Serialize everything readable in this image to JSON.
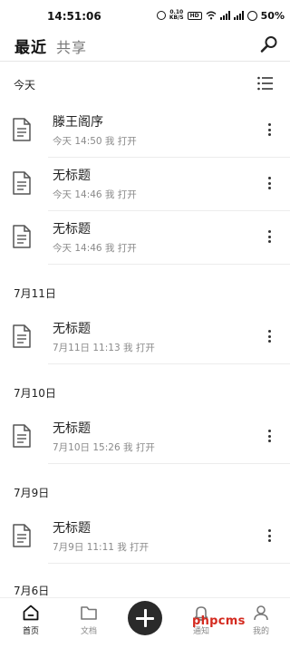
{
  "status_bar": {
    "time": "14:51:06",
    "net_speed_value": "0.10",
    "net_speed_unit": "KB/S",
    "hd_badge": "HD",
    "battery_percent": "50%"
  },
  "header": {
    "tab_recent": "最近",
    "tab_shared": "共享"
  },
  "sections": [
    {
      "title": "今天",
      "items": [
        {
          "title": "滕王阁序",
          "subtitle": "今天 14:50 我 打开"
        },
        {
          "title": "无标题",
          "subtitle": "今天 14:46 我 打开"
        },
        {
          "title": "无标题",
          "subtitle": "今天 14:46 我 打开"
        }
      ]
    },
    {
      "title": "7月11日",
      "items": [
        {
          "title": "无标题",
          "subtitle": "7月11日 11:13 我 打开"
        }
      ]
    },
    {
      "title": "7月10日",
      "items": [
        {
          "title": "无标题",
          "subtitle": "7月10日 15:26 我 打开"
        }
      ]
    },
    {
      "title": "7月9日",
      "items": [
        {
          "title": "无标题",
          "subtitle": "7月9日 11:11 我 打开"
        }
      ]
    },
    {
      "title": "7月6日",
      "items": []
    }
  ],
  "bottom_nav": {
    "home": "首页",
    "docs": "文档",
    "notifications": "通知",
    "me": "我的",
    "watermark": "phpcms"
  },
  "icons": {
    "search": "search-icon",
    "list_view": "list-view-icon",
    "document": "document-icon",
    "more": "more-vertical-icon",
    "home": "home-icon",
    "folder": "folder-icon",
    "add": "plus-icon",
    "bell": "bell-icon",
    "user": "user-icon"
  }
}
